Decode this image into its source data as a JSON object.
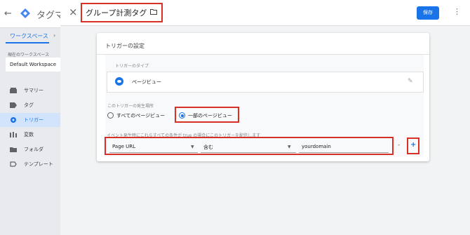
{
  "app": {
    "title": "タグマ",
    "tab_label": "ワークスペース",
    "workspace_label": "現在のワークスペース",
    "workspace_name": "Default Workspace",
    "nav": [
      {
        "label": "サマリー",
        "icon": "summary-icon"
      },
      {
        "label": "タグ",
        "icon": "tag-icon"
      },
      {
        "label": "トリガー",
        "icon": "trigger-icon"
      },
      {
        "label": "変数",
        "icon": "variables-icon"
      },
      {
        "label": "フォルダ",
        "icon": "folder-icon"
      },
      {
        "label": "テンプレート",
        "icon": "template-icon"
      }
    ]
  },
  "panel": {
    "title": "グループ計測タグ",
    "save_label": "保存"
  },
  "card": {
    "title": "トリガーの設定",
    "type_label": "トリガーのタイプ",
    "type_name": "ページビュー",
    "fires_label": "このトリガーの発生場所",
    "radio_all": "すべてのページビュー",
    "radio_some": "一部のページビュー",
    "condition_label": "イベント発生時にこれらすべての条件が true の場合にこのトリガーを配信します",
    "condition": {
      "variable": "Page URL",
      "operator": "含む",
      "value": "yourdomain"
    },
    "minus": "-",
    "plus": "+"
  },
  "colors": {
    "accent": "#1a73e8",
    "highlight": "#d93025"
  }
}
